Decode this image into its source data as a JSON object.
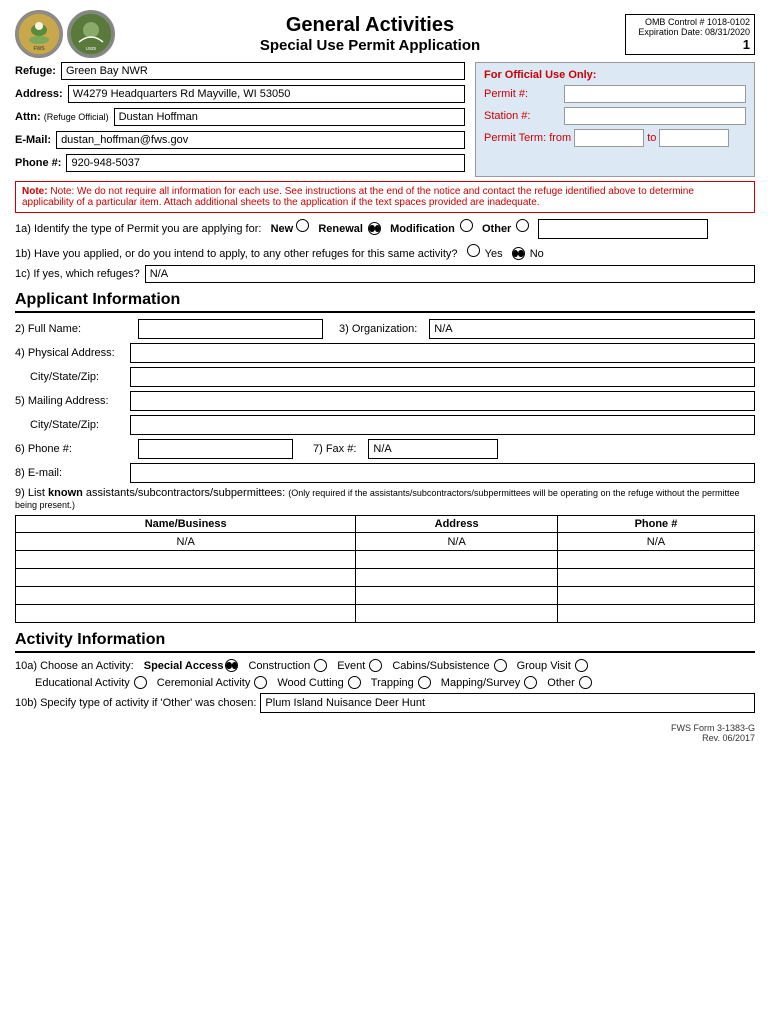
{
  "header": {
    "title": "General Activities",
    "subtitle": "Special Use Permit Application",
    "omb": "OMB Control # 1018-0102",
    "expiration": "Expiration Date: 08/31/2020",
    "page_num": "1"
  },
  "refuge_info": {
    "refuge_label": "Refuge:",
    "refuge_value": "Green Bay NWR",
    "address_label": "Address:",
    "address_value": "W4279 Headquarters Rd Mayville, WI 53050",
    "attn_label": "Attn:",
    "attn_sublabel": "(Refuge Official)",
    "attn_value": "Dustan Hoffman",
    "email_label": "E-Mail:",
    "email_value": "dustan_hoffman@fws.gov",
    "phone_label": "Phone #:",
    "phone_value": "920-948-5037"
  },
  "official_use": {
    "title": "For Official Use Only:",
    "permit_label": "Permit #:",
    "permit_value": "",
    "station_label": "Station #:",
    "station_value": "",
    "term_label": "Permit Term: from",
    "term_from": "",
    "term_to_label": "to",
    "term_to": ""
  },
  "note": "Note: We do not require all information for each use. See instructions at the end of the notice and contact the refuge identified above to determine applicability of a particular item.  Attach additional sheets to the application if the text spaces provided are inadequate.",
  "questions": {
    "q1a_label": "1a) Identify the type of Permit you are applying for:",
    "q1a_options": [
      "New",
      "Renewal",
      "Modification",
      "Other"
    ],
    "q1a_checked": "Renewal",
    "q1a_other_value": "",
    "q1b_label": "1b) Have you applied, or do you intend to apply, to any other refuges for this same activity?",
    "q1b_options": [
      "Yes",
      "No"
    ],
    "q1b_checked": "No",
    "q1c_label": "1c) If yes, which refuges?",
    "q1c_value": "N/A"
  },
  "applicant_info": {
    "heading": "Applicant Information",
    "q2_label": "2) Full Name:",
    "q2_value": "",
    "q3_label": "3) Organization:",
    "q3_value": "N/A",
    "q4_label": "4) Physical Address:",
    "q4_value": "",
    "q4_city_label": "City/State/Zip:",
    "q4_city_value": "",
    "q5_label": "5) Mailing Address:",
    "q5_value": "",
    "q5_city_label": "City/State/Zip:",
    "q5_city_value": "",
    "q6_label": "6) Phone #:",
    "q6_value": "",
    "q7_label": "7) Fax #:",
    "q7_value": "N/A",
    "q8_label": "8) E-mail:",
    "q8_value": ""
  },
  "subcontractors": {
    "q9_label": "9) List",
    "q9_bold": "known",
    "q9_rest": " assistants/subcontractors/subpermittees:",
    "q9_note": "(Only required if the assistants/subcontractors/subpermittees will be operating on the refuge without the permittee being present.)",
    "col_name": "Name/Business",
    "col_address": "Address",
    "col_phone": "Phone #",
    "rows": [
      {
        "name": "N/A",
        "address": "N/A",
        "phone": "N/A"
      },
      {
        "name": "",
        "address": "",
        "phone": ""
      },
      {
        "name": "",
        "address": "",
        "phone": ""
      },
      {
        "name": "",
        "address": "",
        "phone": ""
      },
      {
        "name": "",
        "address": "",
        "phone": ""
      }
    ]
  },
  "activity_info": {
    "heading": "Activity Information",
    "q10a_prefix": "10a) Choose an Activity:",
    "q10a_bold": "Special Access",
    "q10a_options": [
      {
        "label": "Special Access",
        "checked": true
      },
      {
        "label": "Construction",
        "checked": false
      },
      {
        "label": "Event",
        "checked": false
      },
      {
        "label": "Cabins/Subsistence",
        "checked": false
      },
      {
        "label": "Group Visit",
        "checked": false
      },
      {
        "label": "Educational Activity",
        "checked": false
      },
      {
        "label": "Ceremonial Activity",
        "checked": false
      },
      {
        "label": "Wood Cutting",
        "checked": false
      },
      {
        "label": "Trapping",
        "checked": false
      },
      {
        "label": "Mapping/Survey",
        "checked": false
      },
      {
        "label": "Other",
        "checked": false
      }
    ],
    "q10b_label": "10b) Specify type of activity if 'Other' was chosen:",
    "q10b_value": "Plum Island Nuisance Deer Hunt"
  },
  "footer": {
    "form": "FWS Form 3-1383-G",
    "rev": "Rev. 06/2017"
  }
}
